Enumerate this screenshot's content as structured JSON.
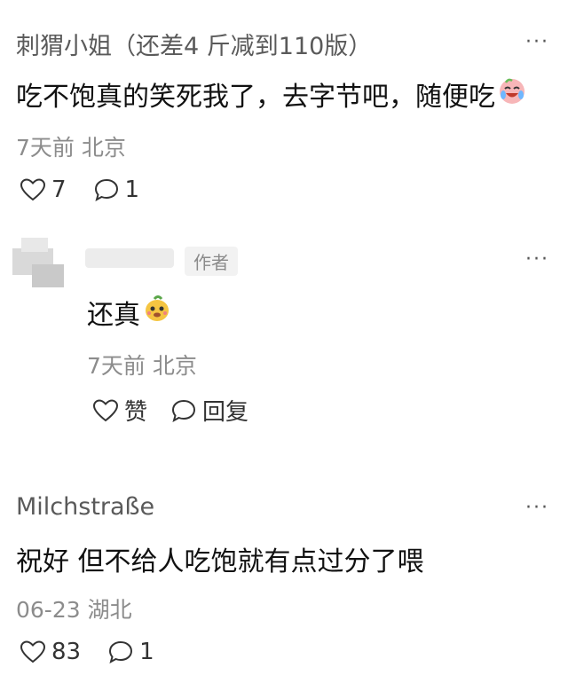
{
  "comments": [
    {
      "username": "刺猬小姐（还差4 斤减到110版）",
      "text": "吃不饱真的笑死我了，去字节吧，随便吃",
      "time": "7天前",
      "location": "北京",
      "likes": "7",
      "replies": "1",
      "more": "···",
      "emoji": "crying-laughing-face-emoji"
    },
    {
      "author_badge": "作者",
      "text": "还真",
      "time": "7天前",
      "location": "北京",
      "like_label": "赞",
      "reply_label": "回复",
      "more": "···",
      "emoji": "smirking-fruit-face-emoji"
    },
    {
      "username": "Milchstraße",
      "text": "祝好 但不给人吃饱就有点过分了喂",
      "time": "06-23",
      "location": "湖北",
      "likes": "83",
      "replies": "1",
      "more": "···"
    }
  ]
}
